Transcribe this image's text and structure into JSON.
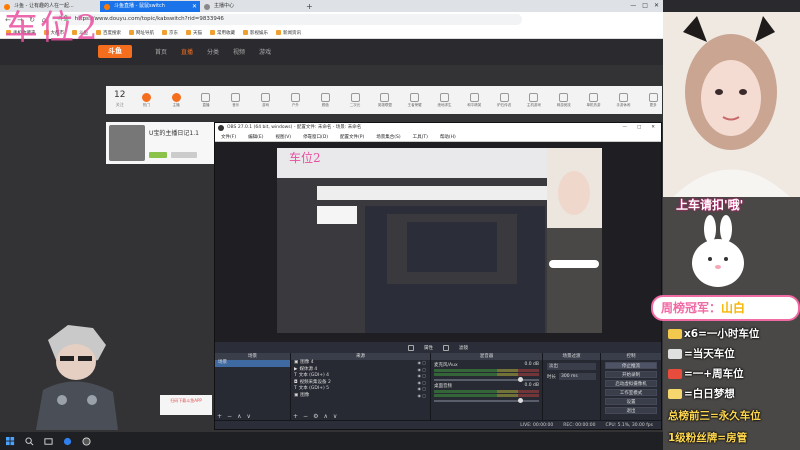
{
  "browser": {
    "tabs": [
      {
        "label": "斗鱼 - 让有趣的人在一起..."
      },
      {
        "label": "斗鱼直播 - 鼠鼠switch"
      },
      {
        "label": "主播中心"
      }
    ],
    "new_tab": "+",
    "url_secure": "斗鱼",
    "url": "https://www.douyu.com/topic/kabswitch?rid=9833946",
    "win_controls": [
      "—",
      "□",
      "✕"
    ],
    "bookmarks": [
      "手机收藏夹",
      "大都市",
      "斗鱼",
      "百度搜索",
      "网址导航",
      "京东",
      "天猫",
      "常用收藏",
      "影视娱乐",
      "新闻资讯"
    ]
  },
  "site": {
    "logo": "斗鱼",
    "nav": [
      "首页",
      "直播",
      "分类",
      "视频",
      "游戏"
    ],
    "nav_active": 1,
    "cat_count": "12",
    "cat_count_sub": "关注",
    "categories": [
      "热门",
      "主播",
      "直播",
      "音乐",
      "游戏",
      "户外",
      "颜值",
      "二次元",
      "英雄联盟",
      "王者荣耀",
      "绝地求生",
      "和平精英",
      "炉石传说",
      "主机游戏",
      "网游竞技",
      "单机热游",
      "手游休闲",
      "更多"
    ],
    "room_title": "U宝的主播日记1.1",
    "qr_text": "扫码下载斗鱼APP"
  },
  "overlay": {
    "big_label": "车位2",
    "panel_title": "上车请扣'哦'",
    "rank_prefix": "周榜冠军：",
    "rank_name": "山白",
    "rules": [
      "x6=一小时车位",
      "=当天车位",
      "=一+周车位",
      "=白日梦想",
      "总榜前三=永久车位",
      "1级粉丝牌=房管"
    ]
  },
  "obs": {
    "title": "OBS 27.0.1 (64 bit, windows) - 配置文件: 未命名 - 场景: 未命名",
    "menu": [
      "文件(F)",
      "编辑(E)",
      "视图(V)",
      "停靠窗口(D)",
      "配置文件(P)",
      "场景集合(S)",
      "工具(T)",
      "帮助(H)"
    ],
    "mode_label": "未选择源",
    "separator_items": [
      "属性",
      "滤镜"
    ],
    "docks": {
      "scenes": {
        "header": "场景",
        "items": [
          "场景"
        ]
      },
      "sources": {
        "header": "来源",
        "items": [
          "图像 4",
          "媒体源 4",
          "文本 (GDI+) 4",
          "视频采集设备 2",
          "文本 (GDI+) 5",
          "图像"
        ]
      },
      "mixer": {
        "header": "混音器",
        "items": [
          {
            "name": "麦克风/Aux",
            "db": "0.0 dB"
          },
          {
            "name": "桌面音频",
            "db": "0.0 dB"
          }
        ]
      },
      "transitions": {
        "header": "场景过渡",
        "type": "淡出",
        "duration_label": "时长",
        "duration": "300 ms"
      },
      "controls": {
        "header": "控制",
        "buttons": [
          "停止推流",
          "开始录制",
          "启动虚拟摄像机",
          "工作室模式",
          "设置",
          "退出"
        ]
      }
    },
    "status": [
      "LIVE: 00:00:00",
      "REC: 00:00:00",
      "CPU: 5.1%, 30.00 fps"
    ]
  },
  "colors": {
    "accent": "#f46e1e",
    "overlay_pink": "#e94fa0",
    "obs_bg": "#2b2e38"
  }
}
